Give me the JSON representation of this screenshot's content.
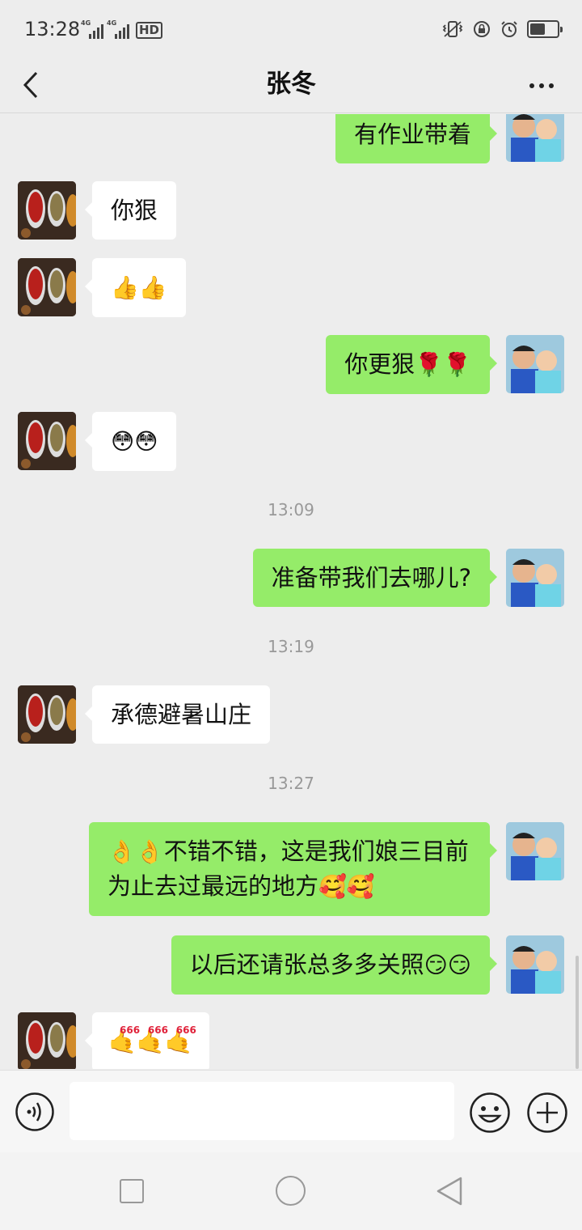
{
  "status": {
    "time": "13:28",
    "network": [
      "4G",
      "4G"
    ],
    "hd_label": "HD",
    "battery_level": 0.55
  },
  "header": {
    "title": "张冬"
  },
  "messages": [
    {
      "side": "out",
      "text": "有作业带着"
    },
    {
      "side": "in",
      "text": "你狠"
    },
    {
      "side": "in",
      "emojis": [
        "👍",
        "👍"
      ]
    },
    {
      "side": "out",
      "text": "你更狠",
      "emojis": [
        "🌹",
        "🌹"
      ]
    },
    {
      "side": "in",
      "emojis": [
        "😳",
        "😳"
      ]
    },
    {
      "type": "time",
      "text": "13:09"
    },
    {
      "side": "out",
      "text": "准备带我们去哪儿?"
    },
    {
      "type": "time",
      "text": "13:19"
    },
    {
      "side": "in",
      "text": "承德避暑山庄"
    },
    {
      "type": "time",
      "text": "13:27"
    },
    {
      "side": "out",
      "prefix_emojis": [
        "👌",
        "👌"
      ],
      "text": "不错不错，这是我们娘三目前为止去过最远的地方",
      "emojis": [
        "🥰",
        "🥰"
      ]
    },
    {
      "side": "out",
      "text": "以后还请张总多多关照",
      "emojis": [
        "😏",
        "😏"
      ]
    },
    {
      "side": "in",
      "emojis": [
        "🤙",
        "🤙",
        "🤙"
      ],
      "emoji_caption": "666"
    }
  ],
  "input": {
    "value": "",
    "placeholder": ""
  },
  "icons": {
    "back": "chevron-left-icon",
    "more": "more-dots-icon",
    "voice": "voice-icon",
    "emoji": "smiley-icon",
    "plus": "plus-icon"
  },
  "colors": {
    "background": "#ededed",
    "bubble_out": "#95ec69",
    "bubble_in": "#ffffff",
    "timestamp": "#999999"
  }
}
